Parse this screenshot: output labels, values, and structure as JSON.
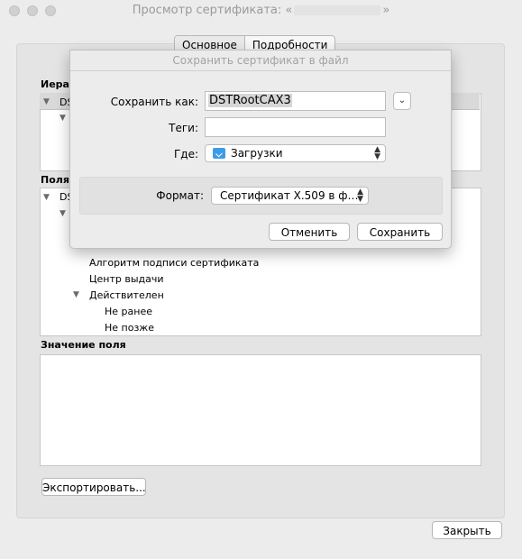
{
  "window": {
    "title_prefix": "Просмотр сертификата: «",
    "title_suffix": "»"
  },
  "tabs": [
    {
      "label": "Основное",
      "active": true
    },
    {
      "label": "Подробности",
      "active": false
    }
  ],
  "labels": {
    "hierarchy_partial": "Иерар",
    "fields_partial": "Поля",
    "field_value": "Значение поля",
    "tree_item_partial": "DS"
  },
  "fields_tree": [
    {
      "label": "Алгоритм подписи сертификата"
    },
    {
      "label": "Центр выдачи"
    },
    {
      "label": "Действителен"
    },
    {
      "label": "Не ранее"
    },
    {
      "label": "Не позже"
    }
  ],
  "buttons": {
    "export": "Экспортировать...",
    "close": "Закрыть"
  },
  "sheet": {
    "title": "Сохранить сертификат в файл",
    "save_as_label": "Сохранить как:",
    "save_as_value": "DSTRootCAX3",
    "tags_label": "Теги:",
    "tags_value": "",
    "where_label": "Где:",
    "where_value": "Загрузки",
    "format_label": "Формат:",
    "format_value": "Сертификат X.509 в ф…",
    "cancel": "Отменить",
    "save": "Сохранить"
  }
}
